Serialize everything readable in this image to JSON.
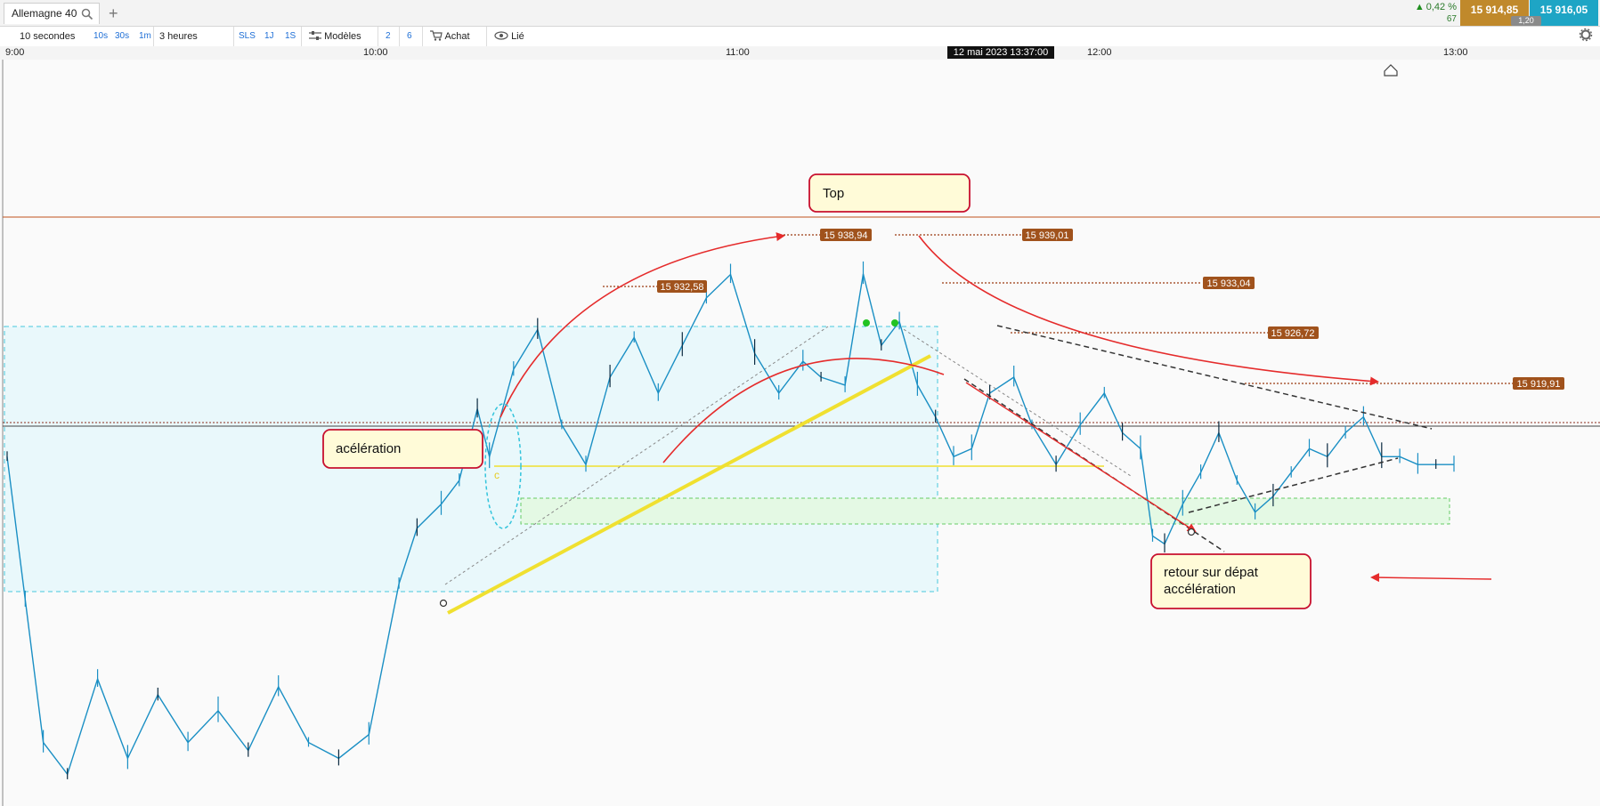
{
  "tabbar": {
    "instrument_tab": "Allemagne 40",
    "add_tab": "+",
    "change_pct": "0,42 %",
    "volume": "67",
    "bid": "15 914,85",
    "ask": "15 916,05",
    "spread": "1,20"
  },
  "toolbar": {
    "interval": "10 secondes",
    "quick_10s": "10s",
    "quick_30s": "30s",
    "quick_1m": "1m",
    "range": "3 heures",
    "quick_sls": "SLS",
    "quick_1j": "1J",
    "quick_1s": "1S",
    "models": "Modèles",
    "num_2": "2",
    "num_6": "6",
    "buy": "Achat",
    "linked": "Lié"
  },
  "time_axis": {
    "labels": [
      "9:00",
      "10:00",
      "11:00",
      "12:00",
      "13:00"
    ],
    "cursor": "12 mai 2023 13:37:00"
  },
  "colors": {
    "price_line": "#1a8fc4",
    "dark_wick": "#0b2a40",
    "price_tag": "#a0521c",
    "callout_border": "#c8102e",
    "callout_fill": "#fffbd8",
    "arrow_red": "#e52b2b",
    "trend_yellow": "#f0e030",
    "zone_fill": "#e9f8fb",
    "green_zone": "#e4f9e4"
  },
  "chart_data": {
    "type": "line",
    "instrument": "Allemagne 40",
    "interval": "10 secondes",
    "x_ticks": [
      "9:00",
      "10:00",
      "11:00",
      "12:00",
      "13:00"
    ],
    "ylim": [
      15872,
      15966
    ],
    "series": [
      {
        "x": [
          "9:00",
          "9:03",
          "9:06",
          "9:10",
          "9:15",
          "9:20",
          "9:25",
          "9:30",
          "9:35",
          "9:40",
          "9:45",
          "9:50",
          "9:55",
          "10:00",
          "10:05",
          "10:08",
          "10:12",
          "10:15",
          "10:18",
          "10:20",
          "10:24",
          "10:28",
          "10:32",
          "10:36",
          "10:40",
          "10:44",
          "10:48",
          "10:52",
          "10:56",
          "11:00",
          "11:04",
          "11:08",
          "11:12",
          "11:15",
          "11:19",
          "11:22",
          "11:25",
          "11:28",
          "11:31",
          "11:34",
          "11:37",
          "11:40",
          "11:43",
          "11:47",
          "11:50",
          "11:54",
          "11:58",
          "12:02",
          "12:05",
          "12:08",
          "12:10",
          "12:12",
          "12:15",
          "12:18",
          "12:21",
          "12:24",
          "12:27",
          "12:30",
          "12:33",
          "12:36",
          "12:39",
          "12:42",
          "12:45",
          "12:48",
          "12:51",
          "12:54",
          "12:57",
          "13:00"
        ],
        "y": [
          15916,
          15898,
          15880,
          15876,
          15888,
          15878,
          15886,
          15880,
          15884,
          15879,
          15887,
          15880,
          15878,
          15881,
          15900,
          15907,
          15910,
          15913,
          15922,
          15916,
          15927,
          15932,
          15920,
          15915,
          15926,
          15931,
          15924,
          15930,
          15936,
          15938.94,
          15929,
          15924,
          15928,
          15926,
          15925,
          15939.01,
          15930,
          15933,
          15925,
          15921,
          15916,
          15917,
          15924,
          15926,
          15920,
          15915,
          15920,
          15924,
          15919,
          15917,
          15906,
          15905,
          15910,
          15914,
          15919,
          15913,
          15909,
          15911,
          15914,
          15917,
          15916,
          15919,
          15921,
          15916,
          15916,
          15915,
          15915,
          15915
        ]
      }
    ],
    "price_labels": [
      "15 932,58",
      "15 938,94",
      "15 939,01",
      "15 933,04",
      "15 926,72",
      "15 919,91"
    ],
    "annotations": {
      "top": "Top",
      "acceleration": "acélération",
      "return_line1": "retour sur dépat",
      "return_line2": "accélération",
      "marker_c": "c"
    }
  }
}
